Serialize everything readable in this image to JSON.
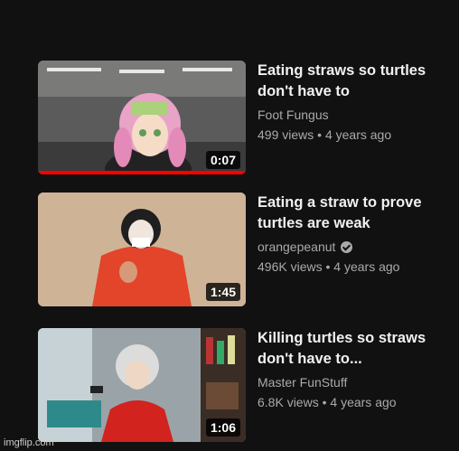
{
  "videos": [
    {
      "title": "Eating straws so turtles don't have to",
      "channel": "Foot Fungus",
      "verified": false,
      "views": "499 views",
      "age": "4 years ago",
      "duration": "0:07",
      "watched_fraction": 1.0
    },
    {
      "title": "Eating a straw to prove turtles are weak",
      "channel": "orangepeanut",
      "verified": true,
      "views": "496K views",
      "age": "4 years ago",
      "duration": "1:45"
    },
    {
      "title": "Killing turtles so straws don't have to...",
      "channel": "Master FunStuff",
      "verified": false,
      "views": "6.8K views",
      "age": "4 years ago",
      "duration": "1:06"
    }
  ],
  "separator": "•",
  "watermark": "imgflip.com",
  "colors": {
    "progress": "#ff0000",
    "background": "#111112"
  }
}
